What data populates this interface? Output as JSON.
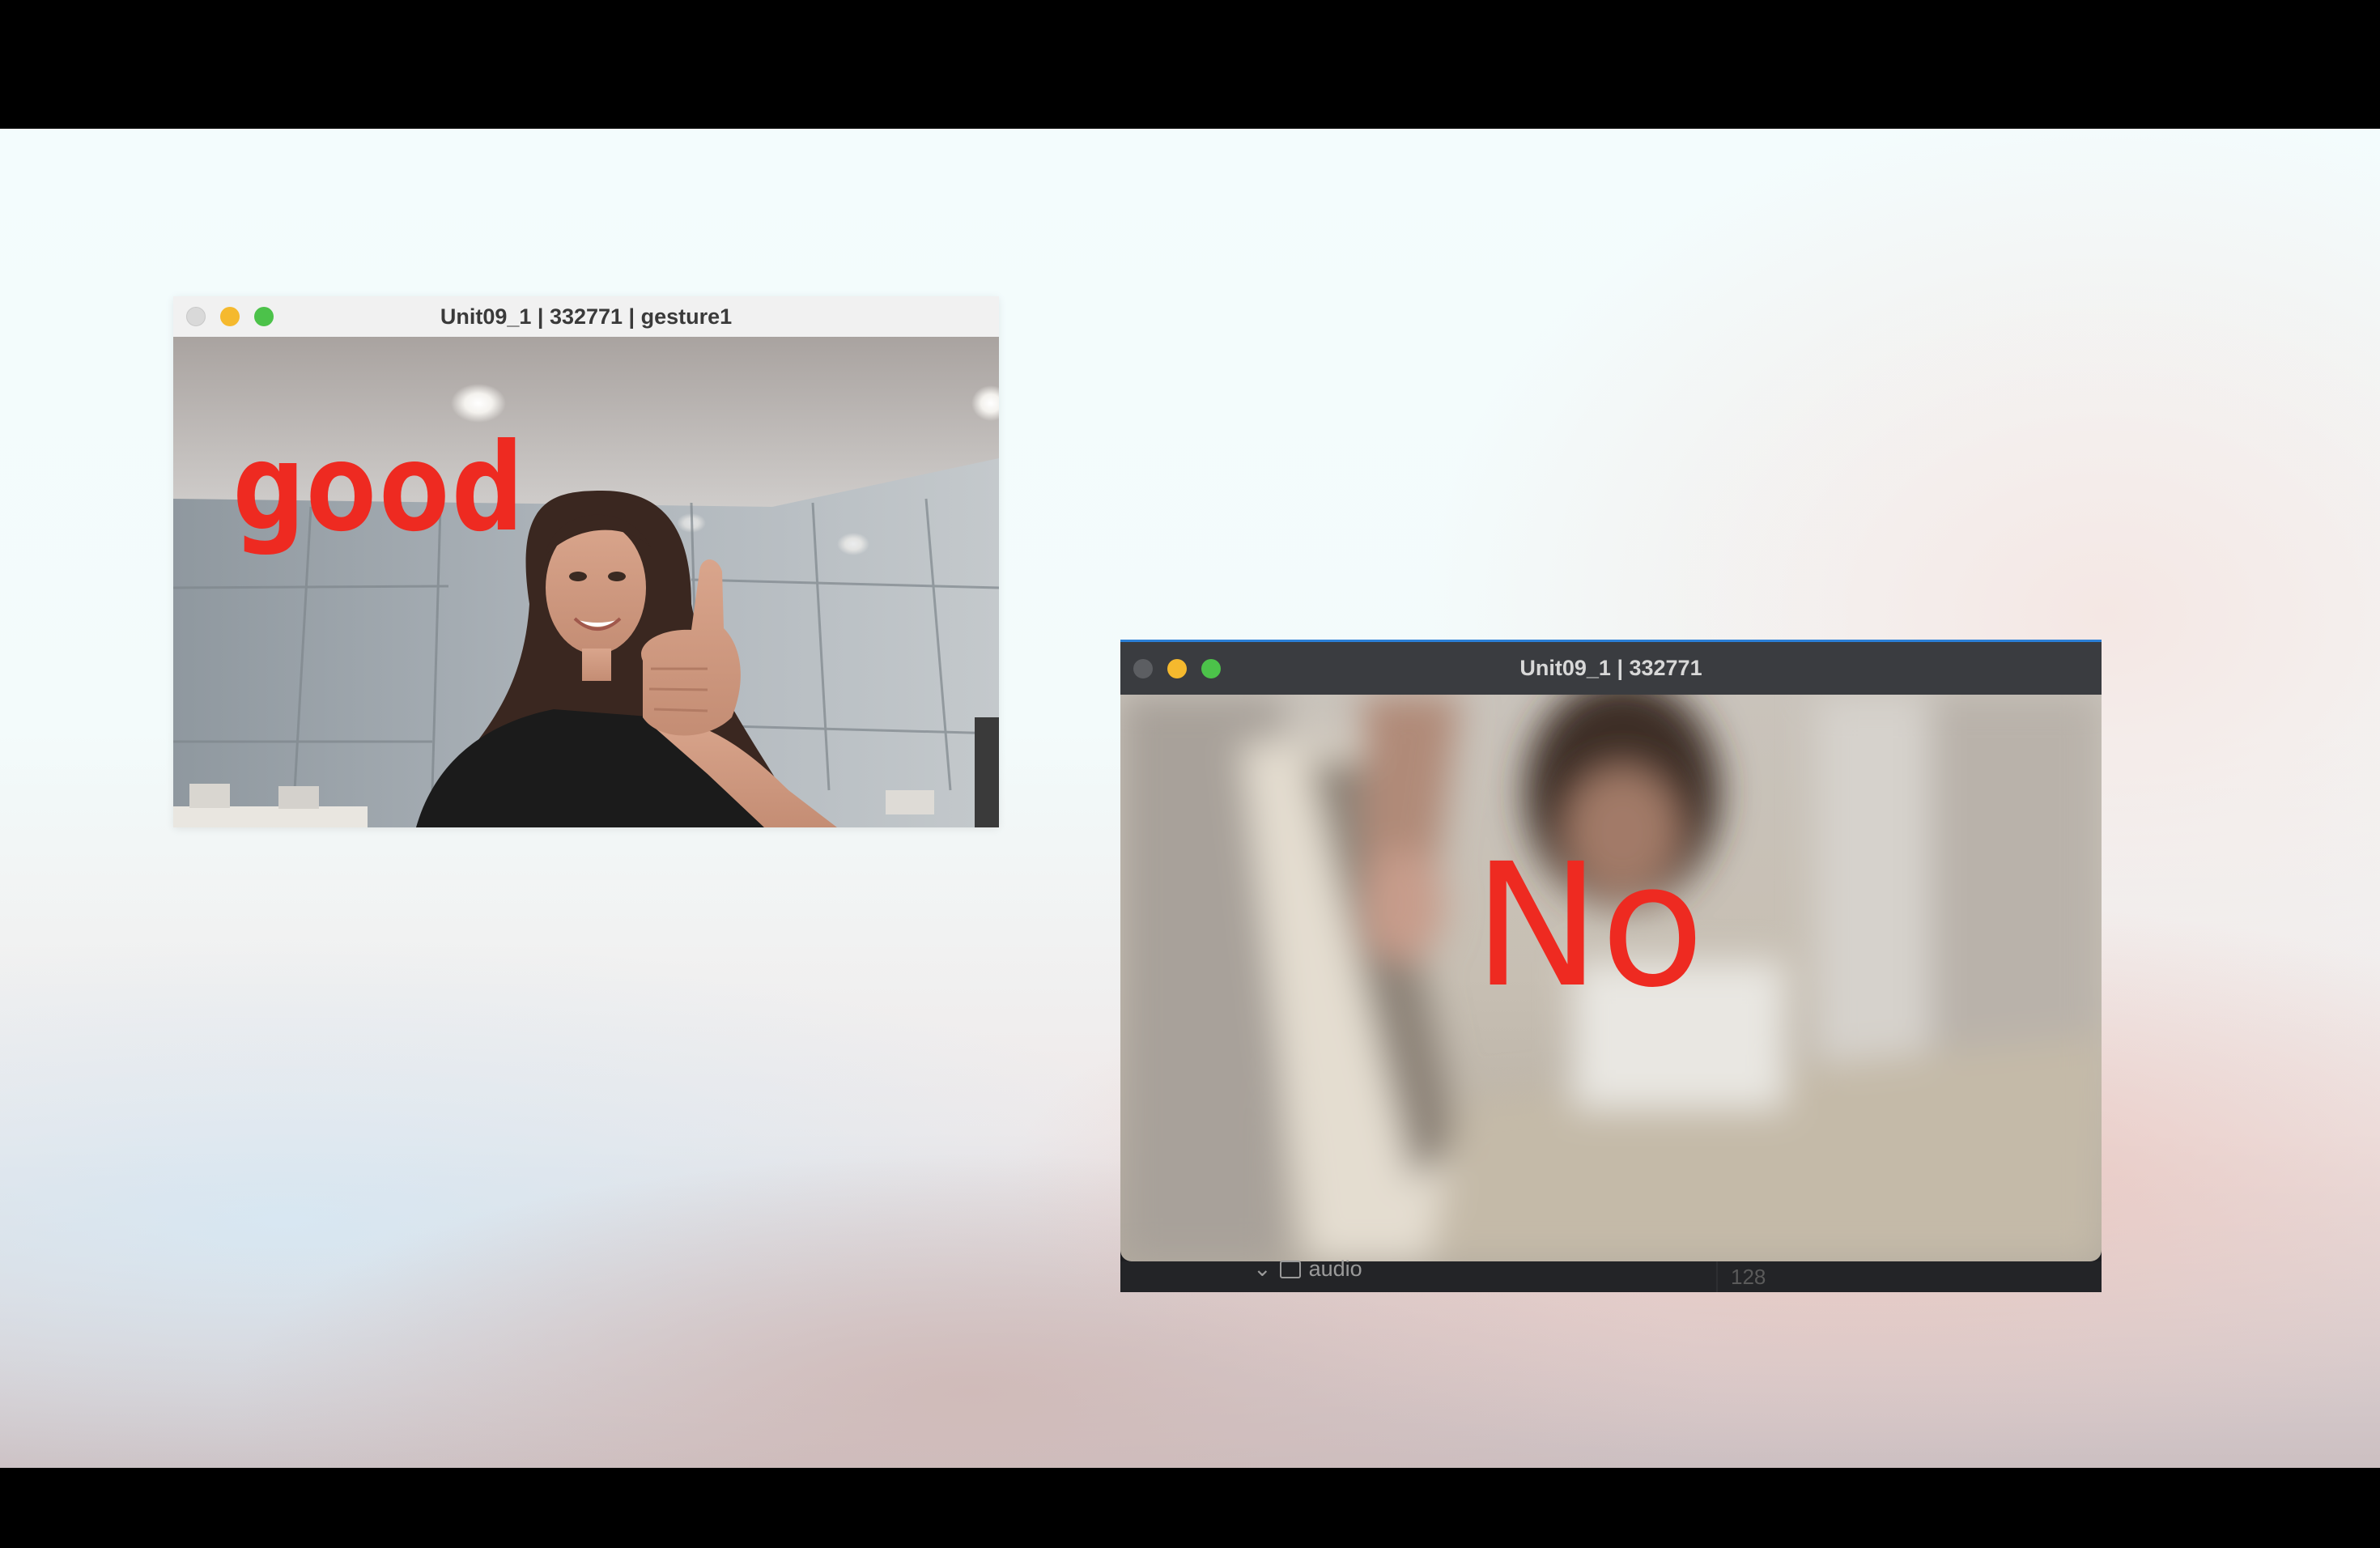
{
  "windows": [
    {
      "title": "Unit09_1 | 332771 | gesture1",
      "overlay_text": "good",
      "scene": "person-thumbs-up-camera-feed"
    },
    {
      "title": "Unit09_1 | 332771",
      "overlay_text": "No",
      "scene": "blurred-camera-feed"
    }
  ],
  "background_window": {
    "folder_label": "audio",
    "number_label": "128"
  },
  "colors": {
    "overlay_text": "#ee2a21",
    "close_button_inactive": "#d9d9d9",
    "minimize_button": "#f5b92e",
    "maximize_button": "#4cc24a"
  }
}
